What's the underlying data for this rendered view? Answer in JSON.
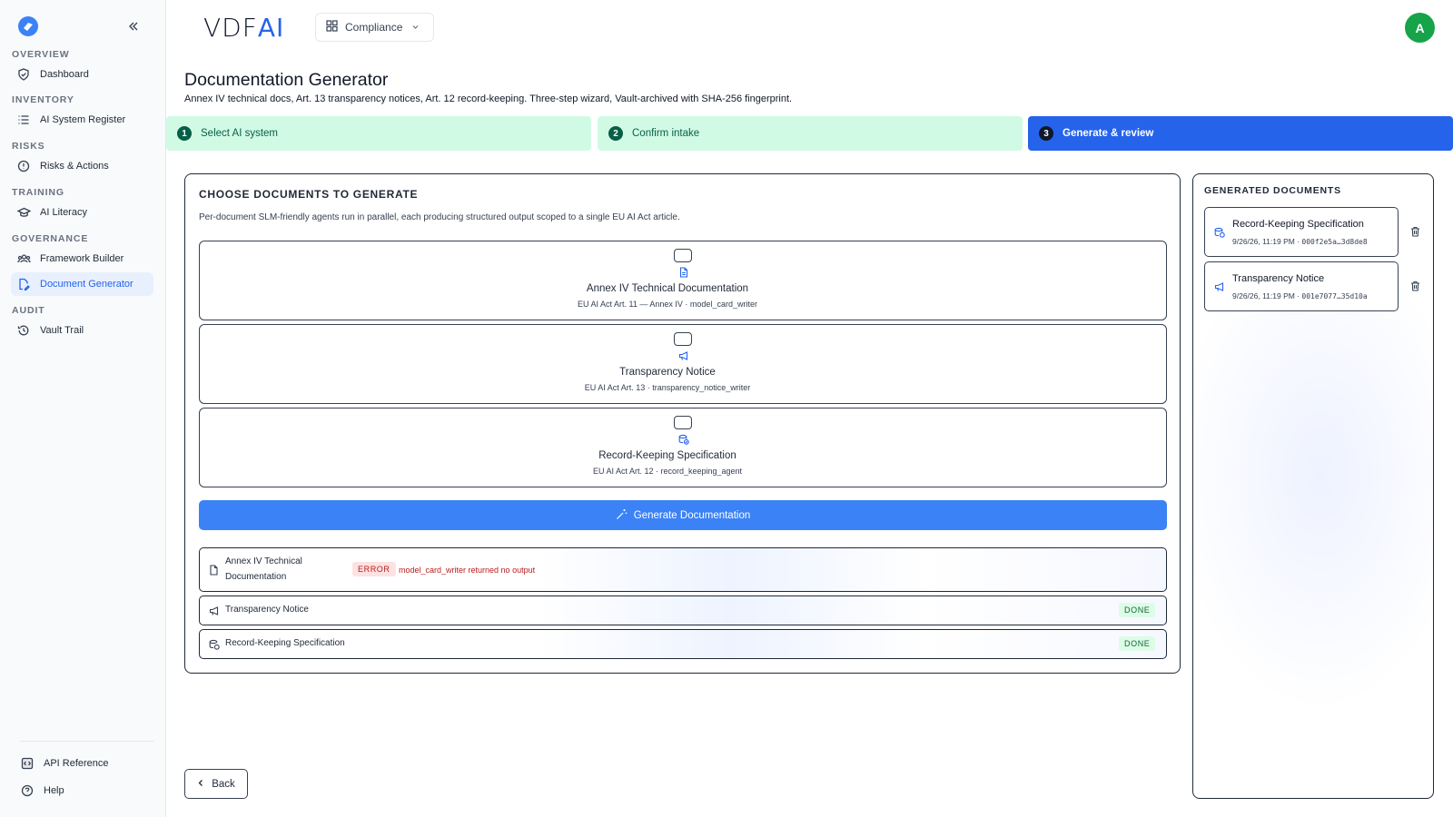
{
  "brand": {
    "name_main": "VDF",
    "name_accent": "AI"
  },
  "workspace": {
    "label": "Compliance"
  },
  "user": {
    "avatar_initial": "A"
  },
  "sidebar": {
    "sections": [
      {
        "title": "OVERVIEW",
        "items": [
          {
            "label": "Dashboard",
            "icon": "shield-check-icon"
          }
        ]
      },
      {
        "title": "INVENTORY",
        "items": [
          {
            "label": "AI System Register",
            "icon": "list-icon"
          }
        ]
      },
      {
        "title": "RISKS",
        "items": [
          {
            "label": "Risks & Actions",
            "icon": "alert-circle-icon"
          }
        ]
      },
      {
        "title": "TRAINING",
        "items": [
          {
            "label": "AI Literacy",
            "icon": "graduation-cap-icon"
          }
        ]
      },
      {
        "title": "GOVERNANCE",
        "items": [
          {
            "label": "Framework Builder",
            "icon": "users-icon"
          },
          {
            "label": "Document Generator",
            "icon": "file-edit-icon",
            "active": true
          }
        ]
      },
      {
        "title": "AUDIT",
        "items": [
          {
            "label": "Vault Trail",
            "icon": "history-icon"
          }
        ]
      }
    ],
    "bottom": [
      {
        "label": "API Reference",
        "icon": "code-box-icon"
      },
      {
        "label": "Help",
        "icon": "help-circle-icon"
      }
    ]
  },
  "page": {
    "title": "Documentation Generator",
    "subtitle": "Annex IV technical docs, Art. 13 transparency notices, Art. 12 record-keeping. Three-step wizard, Vault-archived with SHA-256 fingerprint."
  },
  "steps": [
    {
      "num": "1",
      "label": "Select AI system",
      "state": "done"
    },
    {
      "num": "2",
      "label": "Confirm intake",
      "state": "done"
    },
    {
      "num": "3",
      "label": "Generate & review",
      "state": "current"
    }
  ],
  "choose": {
    "heading": "CHOOSE DOCUMENTS TO GENERATE",
    "description": "Per-document SLM-friendly agents run in parallel, each producing structured output scoped to a single EU AI Act article.",
    "options": [
      {
        "title": "Annex IV Technical Documentation",
        "subtitle": "EU AI Act Art. 11 — Annex IV · model_card_writer",
        "icon": "file-text-icon",
        "checked": false
      },
      {
        "title": "Transparency Notice",
        "subtitle": "EU AI Act Art. 13 · transparency_notice_writer",
        "icon": "megaphone-icon",
        "checked": false
      },
      {
        "title": "Record-Keeping Specification",
        "subtitle": "EU AI Act Art. 12 · record_keeping_agent",
        "icon": "database-check-icon",
        "checked": false
      }
    ],
    "generate_label": "Generate Documentation"
  },
  "results": [
    {
      "label": "Annex IV Technical Documentation",
      "label_line1": "Annex IV Technical",
      "label_line2": "Documentation",
      "status": "ERROR",
      "message": "model_card_writer returned no output",
      "icon": "file-text-icon"
    },
    {
      "label": "Transparency Notice",
      "status": "DONE",
      "icon": "megaphone-icon"
    },
    {
      "label": "Record-Keeping Specification",
      "status": "DONE",
      "icon": "database-check-icon"
    }
  ],
  "back_label": "Back",
  "generated": {
    "heading": "GENERATED DOCUMENTS",
    "items": [
      {
        "title": "Record-Keeping Specification",
        "date": "9/26/26, 11:19 PM",
        "hash": "000f2e5a…3d8de8",
        "icon": "database-check-icon"
      },
      {
        "title": "Transparency Notice",
        "date": "9/26/26, 11:19 PM",
        "hash": "001e7077…35d10a",
        "icon": "megaphone-icon"
      }
    ]
  },
  "colors": {
    "accent": "#2563eb",
    "button": "#3b82f6",
    "step_done_bg": "#d1fae5",
    "error": "#b91c1c",
    "success": "#166534",
    "avatar": "#16a34a"
  }
}
